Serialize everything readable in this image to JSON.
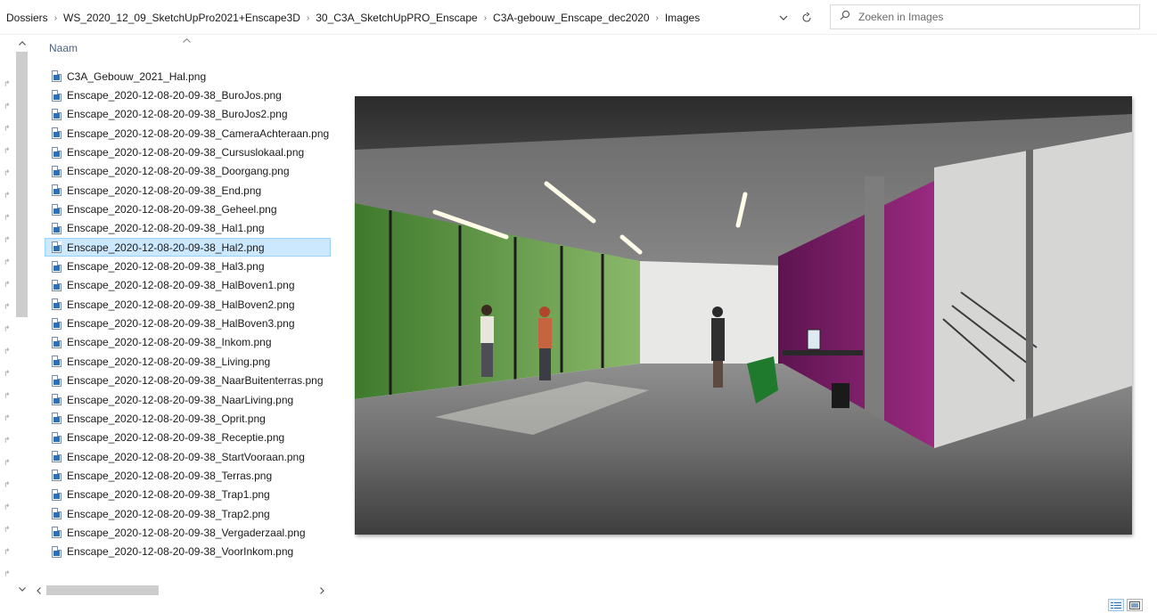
{
  "address_bar": {
    "breadcrumb": [
      "Dossiers",
      "WS_2020_12_09_SketchUpPro2021+Enscape3D",
      "30_C3A_SketchUpPRO_Enscape",
      "C3A-gebouw_Enscape_dec2020",
      "Images"
    ],
    "search_placeholder": "Zoeken in Images"
  },
  "file_list": {
    "column_header": "Naam",
    "selected_index": 9,
    "files": [
      "C3A_Gebouw_2021_Hal.png",
      "Enscape_2020-12-08-20-09-38_BuroJos.png",
      "Enscape_2020-12-08-20-09-38_BuroJos2.png",
      "Enscape_2020-12-08-20-09-38_CameraAchteraan.png",
      "Enscape_2020-12-08-20-09-38_Cursuslokaal.png",
      "Enscape_2020-12-08-20-09-38_Doorgang.png",
      "Enscape_2020-12-08-20-09-38_End.png",
      "Enscape_2020-12-08-20-09-38_Geheel.png",
      "Enscape_2020-12-08-20-09-38_Hal1.png",
      "Enscape_2020-12-08-20-09-38_Hal2.png",
      "Enscape_2020-12-08-20-09-38_Hal3.png",
      "Enscape_2020-12-08-20-09-38_HalBoven1.png",
      "Enscape_2020-12-08-20-09-38_HalBoven2.png",
      "Enscape_2020-12-08-20-09-38_HalBoven3.png",
      "Enscape_2020-12-08-20-09-38_Inkom.png",
      "Enscape_2020-12-08-20-09-38_Living.png",
      "Enscape_2020-12-08-20-09-38_NaarBuitenterras.png",
      "Enscape_2020-12-08-20-09-38_NaarLiving.png",
      "Enscape_2020-12-08-20-09-38_Oprit.png",
      "Enscape_2020-12-08-20-09-38_Receptie.png",
      "Enscape_2020-12-08-20-09-38_StartVooraan.png",
      "Enscape_2020-12-08-20-09-38_Terras.png",
      "Enscape_2020-12-08-20-09-38_Trap1.png",
      "Enscape_2020-12-08-20-09-38_Trap2.png",
      "Enscape_2020-12-08-20-09-38_Vergaderzaal.png",
      "Enscape_2020-12-08-20-09-38_VoorInkom.png"
    ]
  },
  "icons": {
    "dropdown": "chevron-down-icon",
    "refresh": "refresh-icon",
    "search": "search-icon",
    "file": "image-file-icon",
    "details_view": "details-view-icon",
    "large_icons_view": "large-icons-view-icon"
  },
  "colors": {
    "selection": "#cce8ff",
    "selection_border": "#99d1ff",
    "accent_purple": "#8b1e6e",
    "column_header": "#4d6282"
  }
}
